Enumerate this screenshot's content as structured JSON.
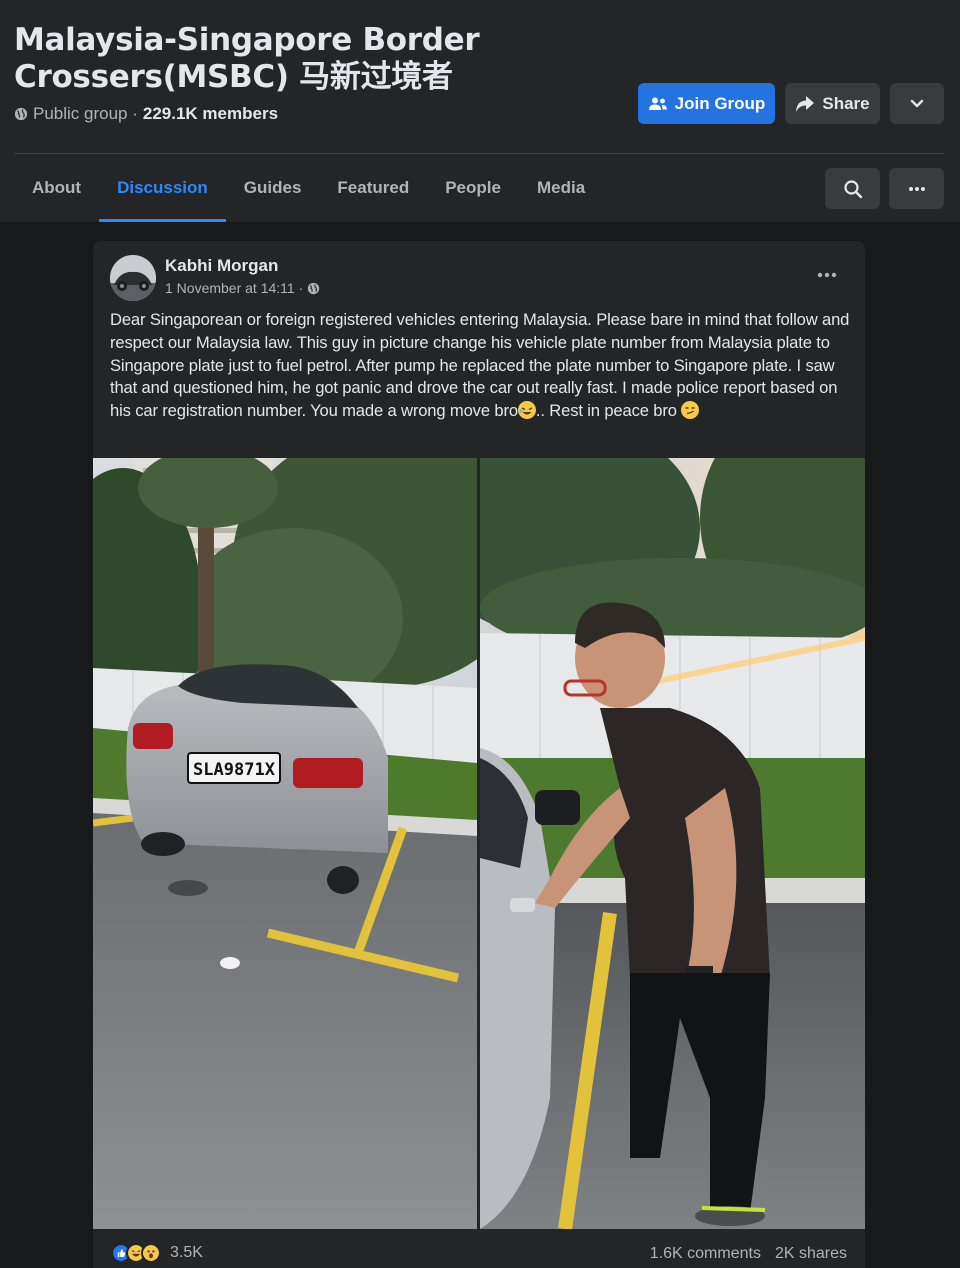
{
  "group": {
    "title": "Malaysia-Singapore Border Crossers(MSBC) 马新过境者",
    "privacy": "Public group ·",
    "members": "229.1K members",
    "join_label": "Join Group",
    "share_label": "Share"
  },
  "tabs": [
    {
      "label": "About"
    },
    {
      "label": "Discussion"
    },
    {
      "label": "Guides"
    },
    {
      "label": "Featured"
    },
    {
      "label": "People"
    },
    {
      "label": "Media"
    }
  ],
  "active_tab": "Discussion",
  "post": {
    "author": "Kabhi Morgan",
    "timestamp": "1 November at 14:11 ·",
    "text_main": "Dear Singaporean or foreign registered vehicles entering Malaysia. Please bare in mind that follow and respect our Malaysia law. This guy in picture change his vehicle plate number from Malaysia plate to Singapore plate just to fuel petrol. After pump he replaced the plate number to Singapore plate. I saw that and questioned him, he got panic and drove the car out really fast. I made police report based on his car registration number. You made a wrong move bro",
    "text_mid": ".. Rest in peace bro ",
    "plate_text": "SLA9871X",
    "reactions_count": "3.5K",
    "comments": "1.6K comments",
    "shares": "2K shares"
  },
  "icons": {
    "privacy": "globe-icon",
    "join": "people-icon",
    "share": "share-arrow-icon",
    "more": "chevron-down-icon",
    "search": "search-icon",
    "menu": "more-horizontal-icon",
    "audience": "globe-icon",
    "reactions": [
      "like-icon",
      "haha-icon",
      "wow-icon"
    ]
  },
  "colors": {
    "accent": "#2374e1",
    "active_tab": "#2d88ff",
    "background": "#18191a",
    "surface": "#242526"
  }
}
